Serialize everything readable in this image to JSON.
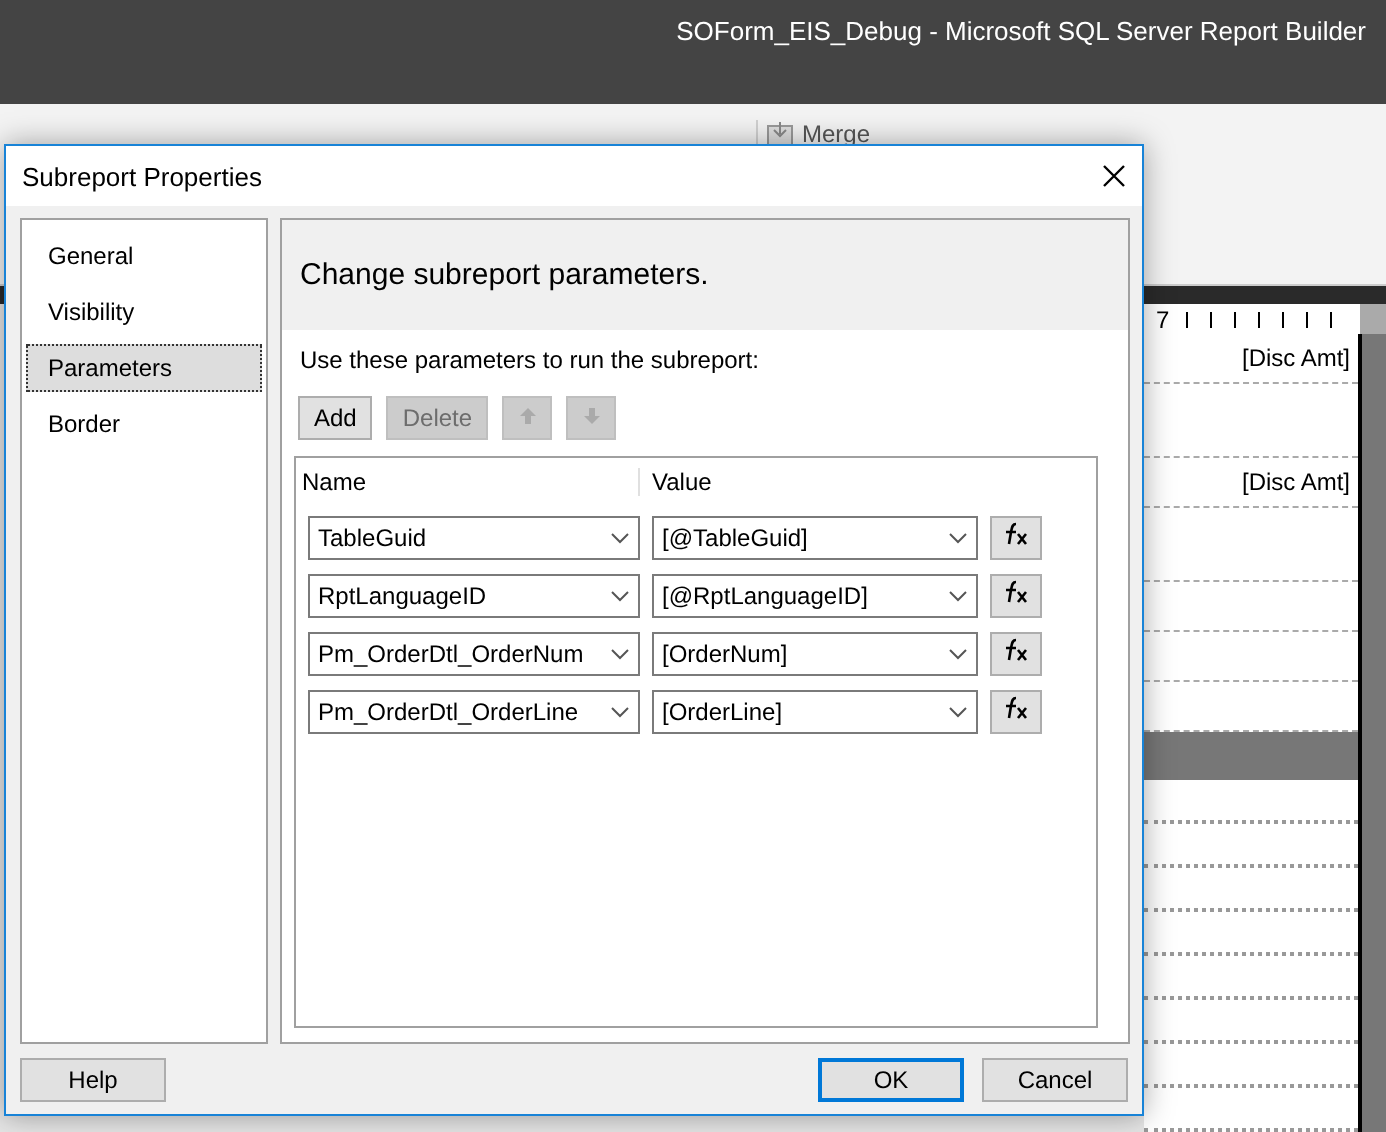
{
  "app": {
    "title": "SOForm_EIS_Debug - Microsoft SQL Server Report Builder",
    "ribbon_button": "Merge"
  },
  "report": {
    "ruler_mark": "7",
    "fields": [
      "[Disc Amt]",
      "[Disc Amt]"
    ]
  },
  "dialog": {
    "title": "Subreport Properties",
    "nav": [
      {
        "label": "General",
        "selected": false
      },
      {
        "label": "Visibility",
        "selected": false
      },
      {
        "label": "Parameters",
        "selected": true
      },
      {
        "label": "Border",
        "selected": false
      }
    ],
    "heading": "Change subreport parameters.",
    "instruction": "Use these parameters to run the subreport:",
    "toolbar": [
      {
        "kind": "text",
        "label": "Add",
        "disabled": false
      },
      {
        "kind": "text",
        "label": "Delete",
        "disabled": true
      },
      {
        "kind": "move-up",
        "disabled": true
      },
      {
        "kind": "move-down",
        "disabled": true
      }
    ],
    "columns": [
      "Name",
      "Value"
    ],
    "rows": [
      {
        "name": "TableGuid",
        "value": "[@TableGuid]"
      },
      {
        "name": "RptLanguageID",
        "value": "[@RptLanguageID]"
      },
      {
        "name": "Pm_OrderDtl_OrderNum",
        "value": "[OrderNum]"
      },
      {
        "name": "Pm_OrderDtl_OrderLine",
        "value": "[OrderLine]"
      }
    ],
    "help_button": "Help",
    "buttons": [
      {
        "label": "OK",
        "default": true
      },
      {
        "label": "Cancel",
        "default": false
      }
    ]
  }
}
